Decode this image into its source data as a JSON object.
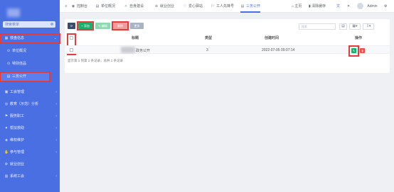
{
  "sidebar": {
    "items": [
      {
        "label": "楼盘信息",
        "icon": "grid-icon",
        "expanded": true
      },
      {
        "label": "单位概况",
        "icon": "dot-icon"
      },
      {
        "label": "特别佳品",
        "icon": "dot-icon"
      },
      {
        "label": "三务公开",
        "icon": "doc-icon"
      },
      {
        "label": "工会管理",
        "icon": "box-icon"
      },
      {
        "label": "教育（示范）分析",
        "icon": "circle-icon"
      },
      {
        "label": "服务职工",
        "icon": "flag-icon"
      },
      {
        "label": "帮扶救助",
        "icon": "heart-icon"
      },
      {
        "label": "维权维护",
        "icon": "shield-icon"
      },
      {
        "label": "参与管理",
        "icon": "hand-icon"
      },
      {
        "label": "就业创业",
        "icon": "gear-icon"
      },
      {
        "label": "系统工会",
        "icon": "building-icon"
      }
    ]
  },
  "topbar": {
    "tabs": [
      {
        "label": "控制台",
        "icon": "dashboard-icon"
      },
      {
        "label": "单位概况",
        "icon": "doc-icon"
      },
      {
        "label": "自身建设",
        "icon": "star-icon"
      },
      {
        "label": "就业创业",
        "icon": "target-icon"
      },
      {
        "label": "爱心驿站",
        "icon": "heart-icon"
      },
      {
        "label": "工人先锋号",
        "icon": "flag-icon"
      },
      {
        "label": "三务公开",
        "icon": "doc-icon",
        "active": true
      }
    ],
    "right": {
      "home": "主页",
      "clear_cache": "清除缓存",
      "user": "Admin"
    }
  },
  "toolbar": {
    "refresh": "⟳",
    "add": "+ 添加",
    "edit": "✎ 编辑",
    "delete": "删除",
    "more": "更多",
    "search_placeholder": "搜索"
  },
  "table": {
    "headers": {
      "title": "标题",
      "type": "类型",
      "created": "创建时间",
      "actions": "操作"
    },
    "rows": [
      {
        "title": "政务公开",
        "type": "3",
        "created": "2022-07-05 09:07:14"
      }
    ]
  },
  "pager": {
    "text": "显示第 1 到第 1 条记录，总共 1 条记录"
  },
  "colors": {
    "accent": "#4a6fe3",
    "success": "#1cae6c",
    "danger": "#e6504f",
    "highlight": "#e43b3b"
  }
}
